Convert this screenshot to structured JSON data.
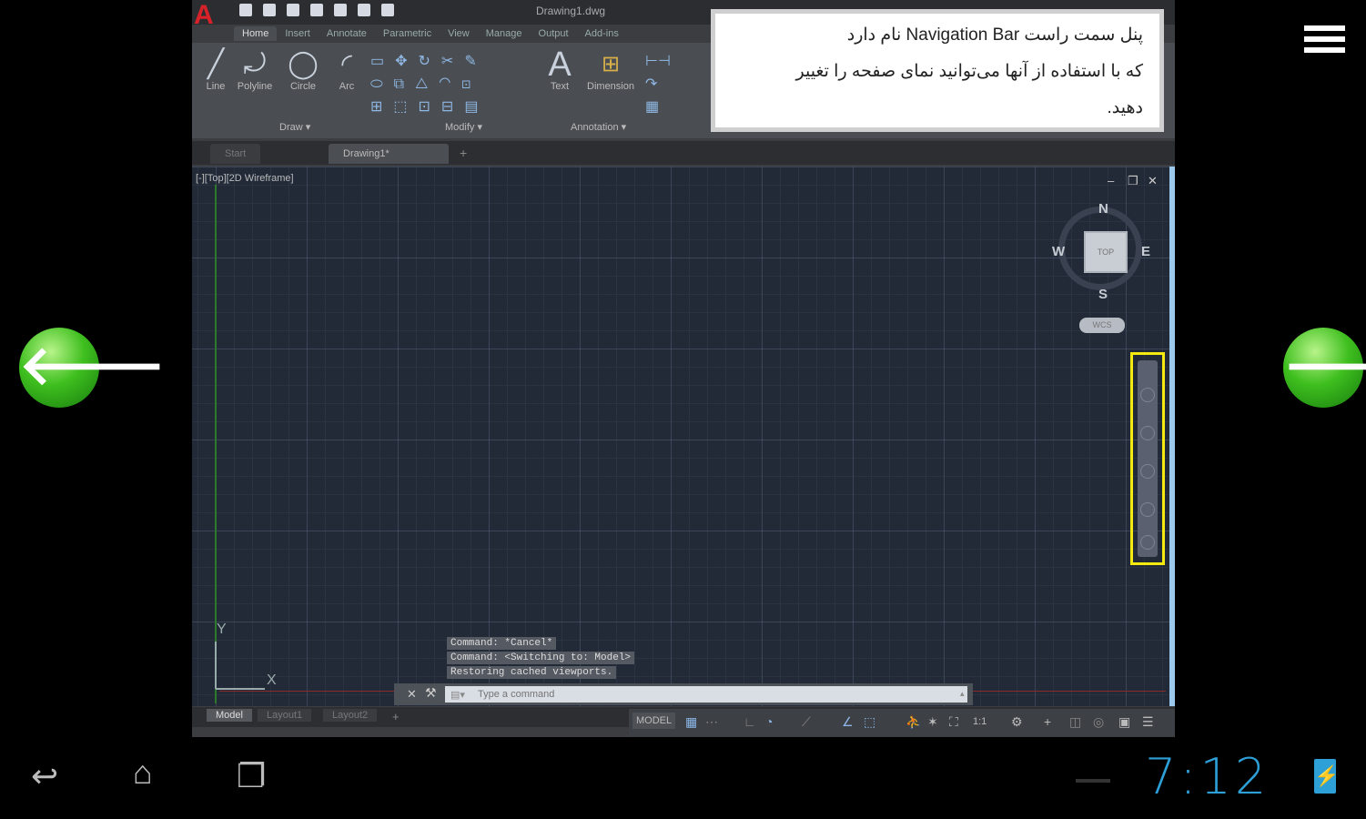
{
  "app": {
    "file_title": "Drawing1.dwg",
    "ribbon_tabs": [
      "Home",
      "Insert",
      "Annotate",
      "Parametric",
      "View",
      "Manage",
      "Output",
      "Add-ins"
    ],
    "draw_tools": [
      "Line",
      "Polyline",
      "Circle",
      "Arc"
    ],
    "annotation_tools": [
      "Text",
      "Dimension"
    ],
    "groups": {
      "draw": "Draw ▾",
      "modify": "Modify ▾",
      "annotation": "Annotation ▾"
    },
    "doc_tabs": [
      "Start",
      "Drawing1*"
    ],
    "doc_tab_add": "+"
  },
  "viewport": {
    "label": "[-][Top][2D Wireframe]",
    "min": "–",
    "restore": "❐",
    "close": "✕",
    "viewcube": {
      "face": "TOP",
      "n": "N",
      "s": "S",
      "e": "E",
      "w": "W"
    },
    "wcs": "WCS",
    "ucs_y": "Y",
    "ucs_x": "X"
  },
  "command": {
    "history": [
      "Command: *Cancel*",
      "Command:  <Switching to: Model>",
      "Restoring cached viewports."
    ],
    "placeholder": "Type a command"
  },
  "layout_tabs": [
    "Model",
    "Layout1",
    "Layout2"
  ],
  "layout_add": "+",
  "status": {
    "model": "MODEL",
    "scale": "1:1"
  },
  "tooltip": {
    "line1": "پنل سمت راست Navigation Bar نام دارد",
    "line2": "که با استفاده از آنها می‌توانید نمای صفحه را تغییر",
    "line3": "دهید."
  },
  "nav": {
    "prev_arrow": "🡐",
    "next_arrow": "🡒"
  },
  "system": {
    "back_icon": "↩",
    "home_icon": "⌂",
    "recents_icon": "❐",
    "clock": "7:12",
    "battery_icon": "⚡"
  },
  "colors": {
    "accent": "#2ea0d8",
    "highlight": "#f4ea10",
    "arrow": "#3fbf1f"
  }
}
